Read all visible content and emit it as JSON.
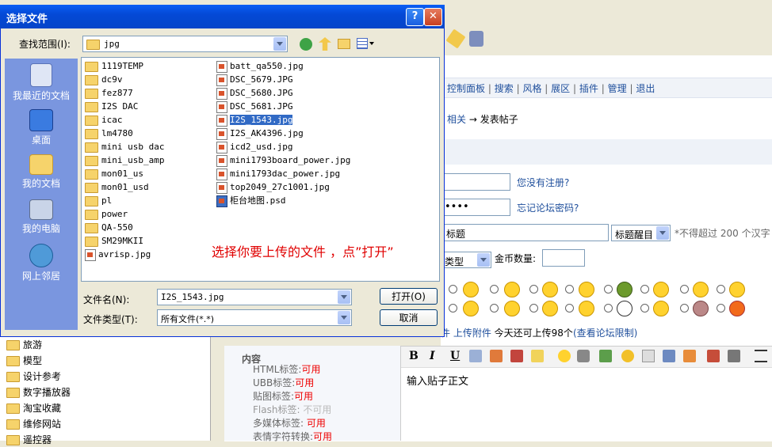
{
  "dialog": {
    "title": "选择文件",
    "help_label": "?",
    "close_label": "✕",
    "look_in_label": "查找范围(I):",
    "look_in_value": "jpg",
    "filename_label": "文件名(N):",
    "filename_value": "I2S_1543.jpg",
    "filetype_label": "文件类型(T):",
    "filetype_value": "所有文件(*.*)",
    "open_label": "打开(O)",
    "cancel_label": "取消",
    "annotation": "选择你要上传的文件 ，点”打开”",
    "places": [
      "我最近的文档",
      "桌面",
      "我的文档",
      "我的电脑",
      "网上邻居"
    ],
    "folders": [
      "1119TEMP",
      "dc9v",
      "fez877",
      "I2S DAC",
      "icac",
      "lm4780",
      "mini usb dac",
      "mini_usb_amp",
      "mon01_us",
      "mon01_usd",
      "pl",
      "power",
      "QA-550",
      "SM29MKII"
    ],
    "files_col1_tail": [
      "avrisp.jpg"
    ],
    "files_col2": [
      "batt_qa550.jpg",
      "DSC_5679.JPG",
      "DSC_5680.JPG",
      "DSC_5681.JPG",
      "I2S_1543.jpg",
      "I2S_AK4396.jpg",
      "icd2_usd.jpg",
      "mini1793board_power.jpg",
      "mini1793dac_power.jpg",
      "top2049_27c1001.jpg",
      "柜台地图.psd"
    ],
    "selected_file": "I2S_1543.jpg"
  },
  "page": {
    "nav": [
      "控制面板",
      "搜索",
      "风格",
      "展区",
      "插件",
      "管理",
      "退出"
    ],
    "nav_sep": "|",
    "breadcrumb_tail": "相关",
    "breadcrumb_arrow": "→",
    "breadcrumb_current": "发表帖子",
    "register_link": "您没有注册?",
    "password_mask": "••••",
    "forgot_link": "忘记论坛密码?",
    "subject_label": "标题",
    "subject_style": "标题醒目",
    "limit_text": "不得超过",
    "limit_num": "200",
    "limit_unit": "个汉字",
    "type_label": "类型",
    "coins_label": "金币数量:",
    "attach_text": "件 上传附件",
    "upload_quota": "今天还可上传98个",
    "quota_link": "(查看论坛限制)",
    "content_label": "内容",
    "editor_placeholder": "输入贴子正文",
    "tags": [
      {
        "name": "HTML标签:",
        "status": "可用"
      },
      {
        "name": "UBB标签:",
        "status": "可用"
      },
      {
        "name": "贴图标签:",
        "status": "可用"
      },
      {
        "name": "Flash标签:",
        "status": "不可用"
      },
      {
        "name": "多媒体标签:",
        "status": "可用"
      },
      {
        "name": "表情字符转换:",
        "status": "可用"
      }
    ]
  },
  "tree": [
    "旅游",
    "模型",
    "设计参考",
    "数字播放器",
    "淘宝收藏",
    "维修网站",
    "遥控器"
  ],
  "colors": {
    "titlebar": "#0a5ef5",
    "places_bg": "#7a96df",
    "selection": "#316ac5",
    "annotation": "#e00000",
    "link": "#1f4f9c"
  }
}
